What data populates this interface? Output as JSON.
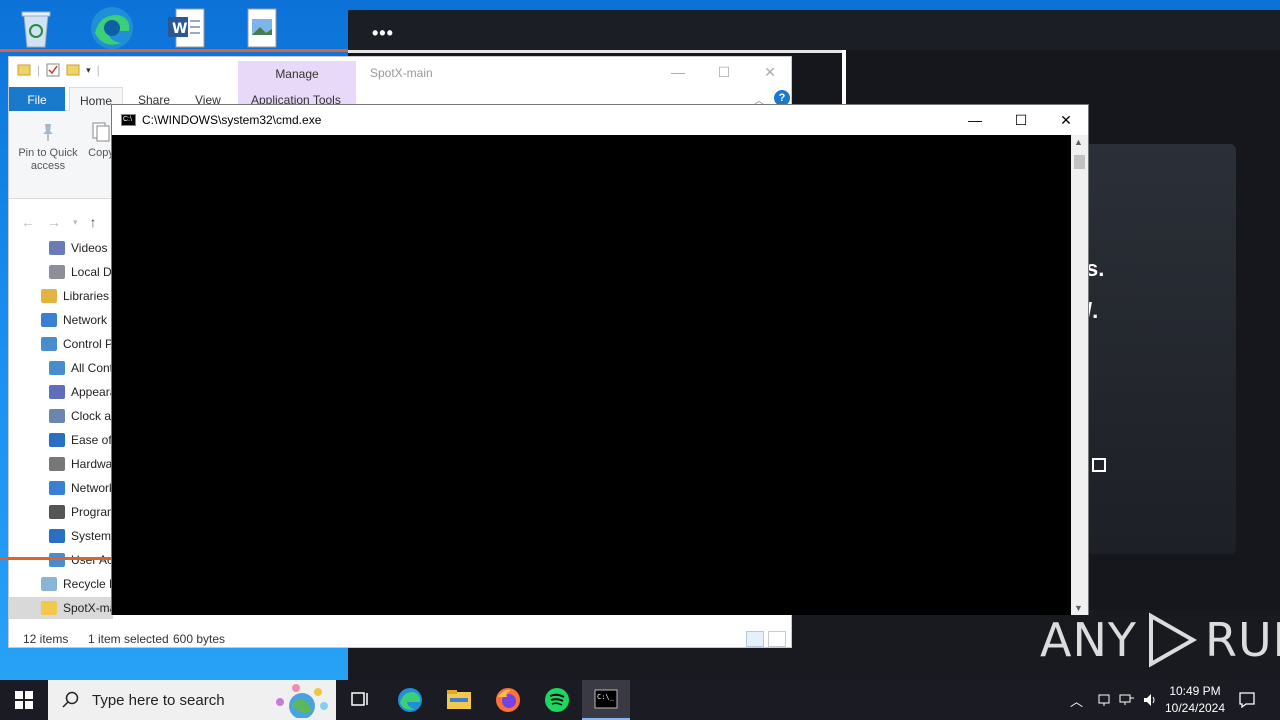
{
  "desktop": {
    "icons": [
      "recycle-bin",
      "edge",
      "word-document",
      "image-file"
    ]
  },
  "background_window": {
    "menu_dots": "•••",
    "partial_text_1": "s.",
    "partial_text_2": "/."
  },
  "explorer": {
    "title": "SpotX-main",
    "manage_tab": "Manage",
    "tabs": [
      "File",
      "Home",
      "Share",
      "View",
      "Application Tools"
    ],
    "ribbon": {
      "pin_label": "Pin to Quick access",
      "copy_label": "Copy"
    },
    "tree": [
      {
        "label": "Videos",
        "color": "#6a7bb8"
      },
      {
        "label": "Local Di",
        "color": "#8a8f99"
      },
      {
        "label": "Libraries",
        "color": "#e3b344"
      },
      {
        "label": "Network",
        "color": "#3b7fd4"
      },
      {
        "label": "Control P",
        "color": "#4a8dcf"
      },
      {
        "label": "All Cont",
        "color": "#4a8dcf"
      },
      {
        "label": "Appeara",
        "color": "#5c6fb8"
      },
      {
        "label": "Clock ar",
        "color": "#6a86b0"
      },
      {
        "label": "Ease of A",
        "color": "#2a6fc4"
      },
      {
        "label": "Hardwa",
        "color": "#777"
      },
      {
        "label": "Network",
        "color": "#3b7fd4"
      },
      {
        "label": "Program",
        "color": "#555"
      },
      {
        "label": "System a",
        "color": "#2a6fc4"
      },
      {
        "label": "User Acc",
        "color": "#4a8dcf"
      },
      {
        "label": "Recycle B",
        "color": "#8ab4d8"
      },
      {
        "label": "SpotX-ma",
        "color": "#f2c94c"
      }
    ],
    "status": {
      "items": "12 items",
      "selected": "1 item selected",
      "size": "600 bytes"
    }
  },
  "cmd": {
    "title": "C:\\WINDOWS\\system32\\cmd.exe"
  },
  "watermark": {
    "left": "ANY",
    "right": "RUN"
  },
  "taskbar": {
    "search_placeholder": "Type here to search",
    "clock_time": "10:49 PM",
    "clock_date": "10/24/2024"
  }
}
